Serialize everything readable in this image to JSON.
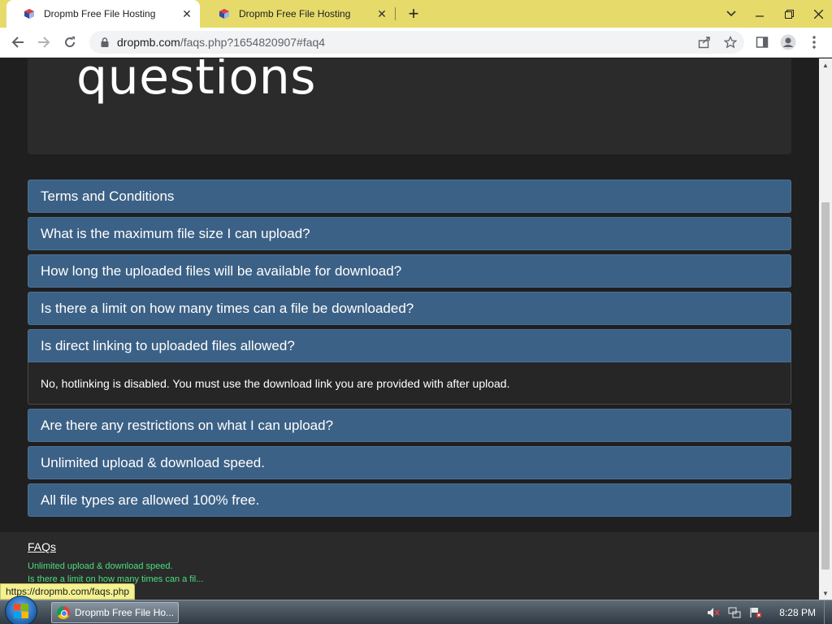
{
  "browser": {
    "tabs": [
      {
        "title": "Dropmb Free File Hosting",
        "active": true
      },
      {
        "title": "Dropmb Free File Hosting",
        "active": false
      }
    ],
    "new_tab_label": "+",
    "address": {
      "host": "dropmb.com",
      "path": "/faqs.php?1654820907#faq4"
    },
    "accent_color": "#e6da6a"
  },
  "page": {
    "hero_title": "questions",
    "faqs": [
      {
        "question": "Terms and Conditions",
        "expanded": false
      },
      {
        "question": "What is the maximum file size I can upload?",
        "expanded": false
      },
      {
        "question": "How long the uploaded files will be available for download?",
        "expanded": false
      },
      {
        "question": "Is there a limit on how many times can a file be downloaded?",
        "expanded": false
      },
      {
        "question": "Is direct linking to uploaded files allowed?",
        "expanded": true,
        "answer": "No, hotlinking is disabled. You must use the download link you are provided with after upload."
      },
      {
        "question": "Are there any restrictions on what I can upload?",
        "expanded": false
      },
      {
        "question": "Unlimited upload & download speed.",
        "expanded": false
      },
      {
        "question": "All file types are allowed 100% free.",
        "expanded": false
      }
    ],
    "faq_header_color": "#3c6186",
    "footer": {
      "title": "FAQs",
      "links": [
        "Unlimited upload & download speed.",
        "Is there a limit on how many times can a fil..."
      ],
      "link_color": "#4ade80"
    },
    "status_url": "https://dropmb.com/faqs.php"
  },
  "taskbar": {
    "task_label": "Dropmb Free File Ho...",
    "clock": "8:28 PM"
  }
}
